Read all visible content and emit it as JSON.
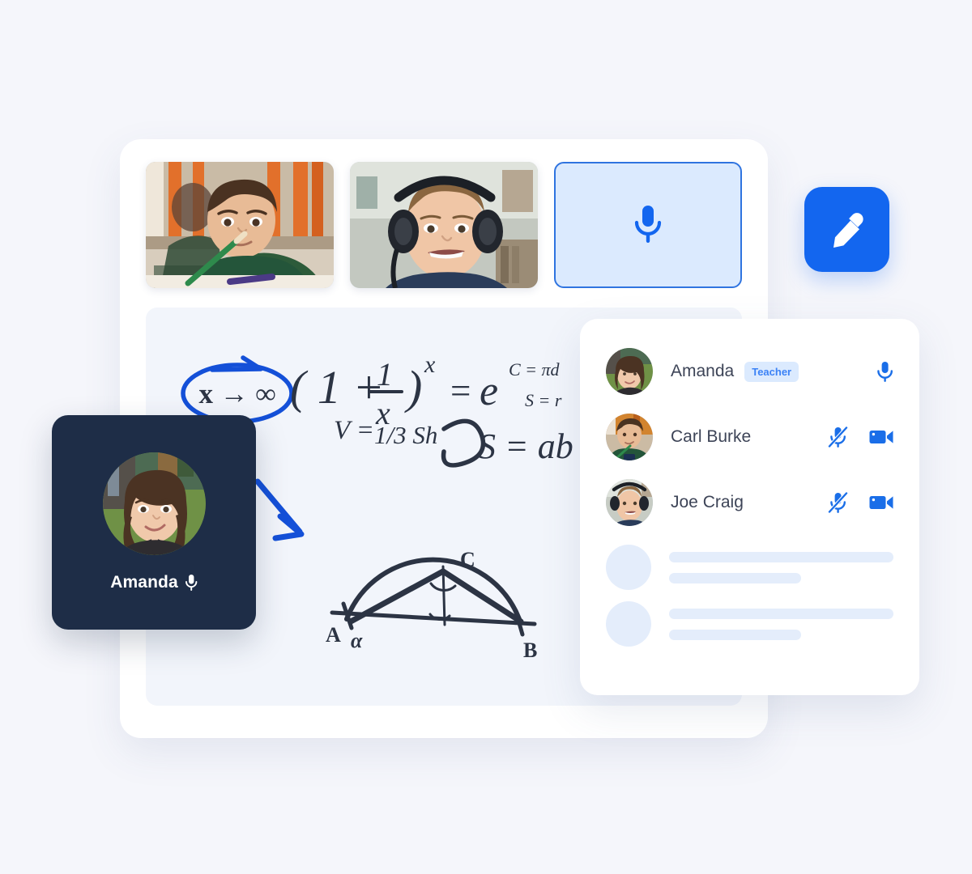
{
  "theme": {
    "page_background": "#f5f6fb",
    "card_background": "#ffffff",
    "whiteboard_background": "#f2f5fb",
    "accent_blue": "#1366ef",
    "icon_blue": "#1a6ee8",
    "badge_background": "#dbeafe",
    "badge_text": "#3b82f6",
    "speaker_card_background": "#1e2d47",
    "name_text": "#3d4457",
    "skeleton": "#e4edfb",
    "annotation_blue": "#1450d8",
    "ink_dark": "#2c3444"
  },
  "video_tiles": [
    {
      "name": "student-video-tile-1",
      "alt": "Boy in green sweater writing with a pencil at a classroom desk"
    },
    {
      "name": "student-video-tile-2",
      "alt": "Smiling boy wearing large black headphones in a classroom"
    }
  ],
  "mic_tile": {
    "name": "microphone-tile",
    "icon": "microphone-icon",
    "label": ""
  },
  "edit_button": {
    "name": "edit-whiteboard-button",
    "icon": "pencil-icon",
    "label": ""
  },
  "whiteboard": {
    "name": "whiteboard-canvas",
    "annotations": {
      "circled_limit": "x → ∞",
      "arrow": "down-right-arrow"
    },
    "formulas": [
      "( 1 + 1/x )^x  = e",
      "V = 1/3 Sh",
      "C = πd",
      "S = r",
      "S = ab"
    ],
    "diagram": {
      "type": "semicircle-inscribed-triangle",
      "labels": [
        "A",
        "α",
        "B",
        "C"
      ]
    }
  },
  "active_speaker": {
    "name": "Amanda",
    "mic_icon": "microphone-icon",
    "mic_state": "on"
  },
  "participants_panel": {
    "title": "",
    "rows": [
      {
        "name": "Amanda",
        "badge": "Teacher",
        "avatar_alt": "Woman with dark wavy hair smiling outdoors",
        "icons": [
          {
            "name": "mic-on-icon",
            "state": "on"
          }
        ]
      },
      {
        "name": "Carl Burke",
        "badge": "",
        "avatar_alt": "Boy in green sweater at a classroom desk",
        "icons": [
          {
            "name": "mic-off-icon",
            "state": "off"
          },
          {
            "name": "video-on-icon",
            "state": "on"
          }
        ]
      },
      {
        "name": "Joe Craig",
        "badge": "",
        "avatar_alt": "Boy wearing black headphones smiling",
        "icons": [
          {
            "name": "mic-off-icon",
            "state": "off"
          },
          {
            "name": "video-on-icon",
            "state": "on"
          }
        ]
      }
    ],
    "placeholder_rows": 2
  }
}
